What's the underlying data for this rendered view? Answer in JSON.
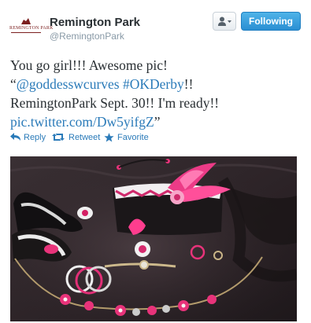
{
  "account": {
    "logo_text": "REMINGTON PARK",
    "name": "Remington Park",
    "handle": "@RemingtonPark"
  },
  "buttons": {
    "following_label": "Following"
  },
  "tweet": {
    "line1": "You go girl!!! Awesome pic!",
    "open_quote": "“",
    "mention": "@goddesswcurves",
    "hashtag": "#OKDerby",
    "after_hashtag": "!!",
    "line3": "RemingtonPark Sept. 30!! I'm ready!!",
    "link": "pic.twitter.com/Dw5yifgZ",
    "close_quote": "”"
  },
  "actions": [
    {
      "label": "Reply",
      "icon": "reply-icon"
    },
    {
      "label": "Retweet",
      "icon": "retweet-icon"
    },
    {
      "label": "Favorite",
      "icon": "star-icon"
    }
  ],
  "colors": {
    "link": "#2b7bb9",
    "follow_button": "#2a8fd3",
    "text": "#292f33",
    "muted": "#8899a6"
  }
}
